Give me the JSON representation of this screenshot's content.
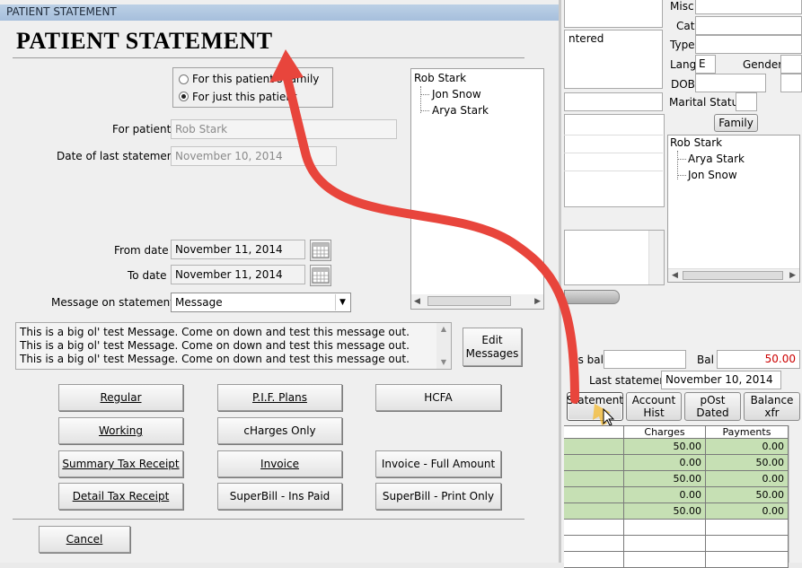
{
  "dialog": {
    "window_title": "PATIENT STATEMENT",
    "heading": "PATIENT STATEMENT",
    "radio_family": "For this patient's family",
    "radio_patient": "For just this patient",
    "for_patient_label": "For patient",
    "for_patient_value": "Rob Stark",
    "last_statement_label": "Date of last statement",
    "last_statement_value": "November 10, 2014",
    "from_date_label": "From date",
    "from_date_value": "November 11, 2014",
    "to_date_label": "To date",
    "to_date_value": "November 11, 2014",
    "message_label": "Message on statement",
    "message_select": "Message",
    "message_text": "This is a big ol' test Message.  Come on down and test this message out.  This is a big ol' test Message.  Come on down and test this message out.  This is a big ol' test Message.  Come on down and test this message out.",
    "edit_messages": "Edit Messages",
    "tree": [
      "Rob Stark",
      "Jon Snow",
      "Arya Stark"
    ],
    "buttons": {
      "regular": "Regular",
      "pif_plans": "P.I.F. Plans",
      "hcfa": "HCFA",
      "working": "Working",
      "charges_only": "cHarges Only",
      "summary_tax": "Summary Tax Receipt",
      "invoice": "Invoice",
      "invoice_full": "Invoice - Full Amount",
      "detail_tax": "Detail Tax Receipt",
      "superbill_ins": "SuperBill - Ins Paid",
      "superbill_print": "SuperBill - Print Only",
      "cancel": "Cancel"
    }
  },
  "background": {
    "misc_label": "Misc",
    "cat_label": "Cat",
    "type_label": "Type",
    "lang_label": "Lang",
    "lang_value": "E",
    "gender_label": "Gender",
    "dob_label": "DOB",
    "marital_label": "Marital Status",
    "family_button": "Family",
    "entered_text": "ntered",
    "tree": [
      "Rob Stark",
      "Arya Stark",
      "Jon Snow"
    ],
    "ins_bal_label": "ns bal",
    "bal_label": "Bal",
    "bal_value": "50.00",
    "last_statement_label": "Last statement",
    "last_statement_value": "November 10, 2014",
    "statement_button": "Statement",
    "account_hist_button": "Account Hist",
    "post_dated_button": "pOst Dated",
    "balance_xfr_button": "Balance xfr",
    "table": {
      "headers": [
        "Charges",
        "Payments"
      ],
      "rows": [
        [
          "50.00",
          "0.00"
        ],
        [
          "0.00",
          "50.00"
        ],
        [
          "50.00",
          "0.00"
        ],
        [
          "0.00",
          "50.00"
        ],
        [
          "50.00",
          "0.00"
        ],
        [
          "",
          ""
        ],
        [
          "",
          ""
        ],
        [
          "",
          ""
        ]
      ]
    },
    "colors": {
      "bal_value": "#cc0000",
      "table_fill": "#c6e0b4",
      "arrow": "#e8453c"
    }
  }
}
